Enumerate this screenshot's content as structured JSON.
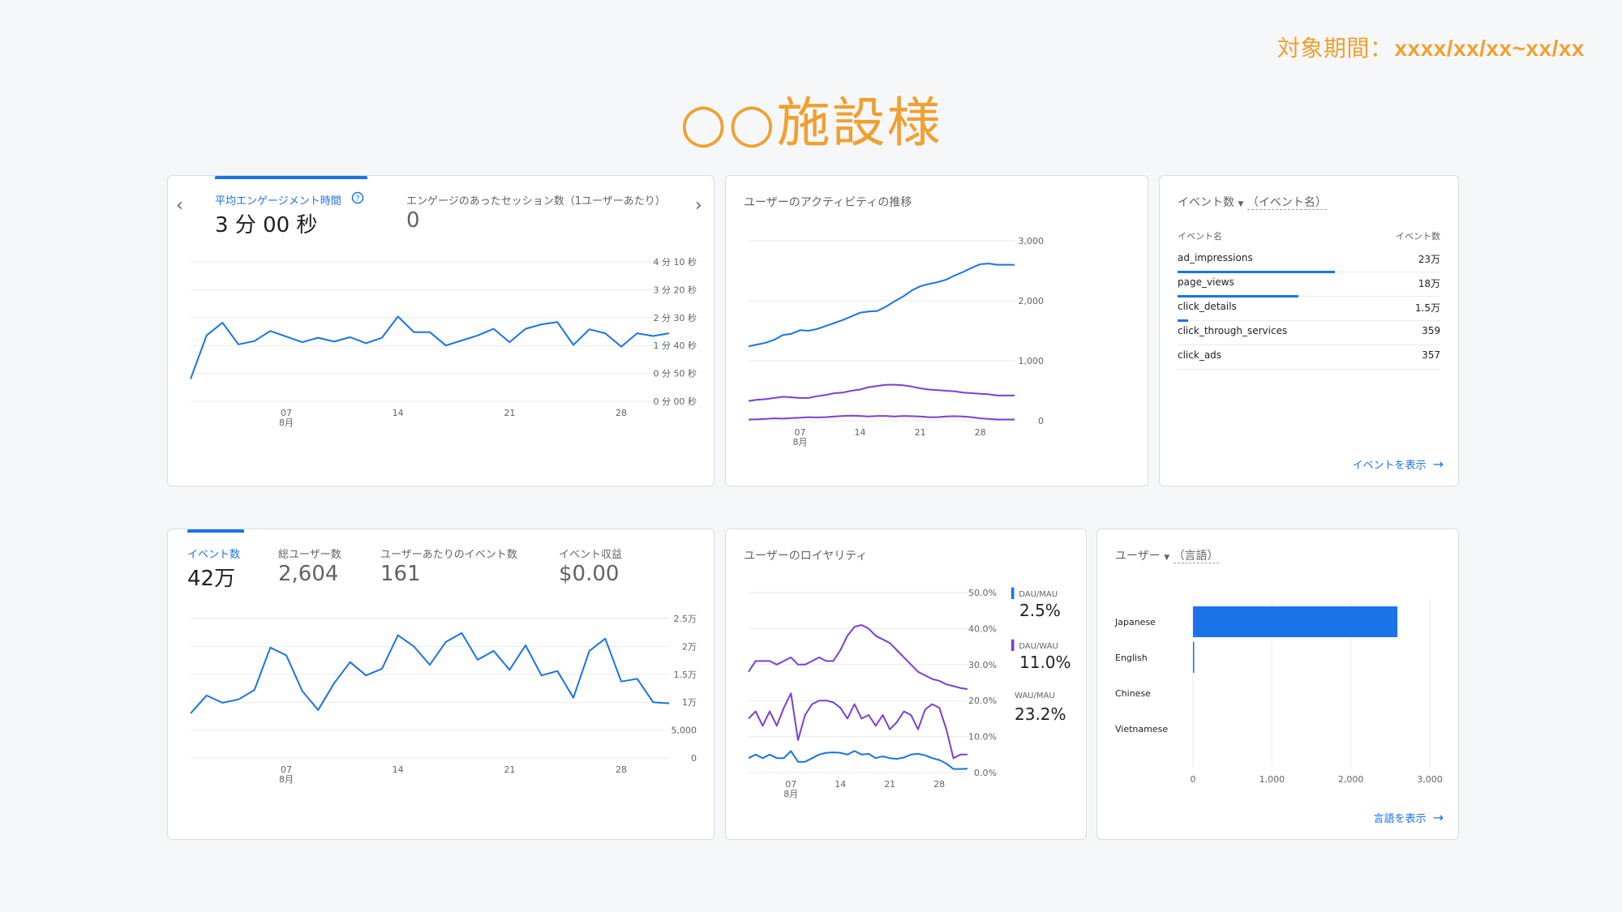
{
  "header": {
    "period_label": "対象期間：",
    "period_value": "xxxx/xx/xx~xx/xx",
    "title": "○○施設様"
  },
  "colors": {
    "accent": "#1a73e8",
    "purple": "#7b3fd6",
    "orange": "#f0a030"
  },
  "engagement_card": {
    "tabs": [
      {
        "label": "平均エンゲージメント時間",
        "value": "3 分 00 秒",
        "selected": true
      },
      {
        "label": "エンゲージのあったセッション数（1ユーザーあたり）",
        "value": "0",
        "selected": false
      }
    ],
    "prev_icon": "chevron-left-icon",
    "next_icon": "chevron-right-icon",
    "help_icon": "help-circle-icon",
    "yticks": [
      "4 分 10 秒",
      "3 分 20 秒",
      "2 分 30 秒",
      "1 分 40 秒",
      "0 分 50 秒",
      "0 分 00 秒"
    ],
    "xticks": [
      "07",
      "14",
      "21",
      "28"
    ],
    "xmonth": "8月"
  },
  "activity_card": {
    "title": "ユーザーのアクティビティの推移",
    "yticks": [
      "3,000",
      "2,000",
      "1,000",
      "0"
    ],
    "xticks": [
      "07",
      "14",
      "21",
      "28"
    ],
    "xmonth": "8月"
  },
  "events_card": {
    "dropdown_label": "イベント数",
    "dimension_label": "（イベント名）",
    "col_name": "イベント名",
    "col_value": "イベント数",
    "rows": [
      {
        "name": "ad_impressions",
        "value": "23万",
        "share": 0.6
      },
      {
        "name": "page_views",
        "value": "18万",
        "share": 0.46
      },
      {
        "name": "click_details",
        "value": "1.5万",
        "share": 0.04
      },
      {
        "name": "click_through_services",
        "value": "359",
        "share": 0
      },
      {
        "name": "click_ads",
        "value": "357",
        "share": 0
      }
    ],
    "link_label": "イベントを表示"
  },
  "events_summary_card": {
    "tabs": [
      {
        "label": "イベント数",
        "value": "42万",
        "selected": true
      },
      {
        "label": "総ユーザー数",
        "value": "2,604",
        "selected": false
      },
      {
        "label": "ユーザーあたりのイベント数",
        "value": "161",
        "selected": false
      },
      {
        "label": "イベント収益",
        "value": "$0.00",
        "selected": false
      }
    ],
    "yticks": [
      "2.5万",
      "2万",
      "1.5万",
      "1万",
      "5,000",
      "0"
    ],
    "xticks": [
      "07",
      "14",
      "21",
      "28"
    ],
    "xmonth": "8月"
  },
  "loyalty_card": {
    "title": "ユーザーのロイヤリティ",
    "yticks": [
      "50.0%",
      "40.0%",
      "30.0%",
      "20.0%",
      "10.0%",
      "0.0%"
    ],
    "xticks": [
      "07",
      "14",
      "21",
      "28"
    ],
    "xmonth": "8月",
    "metrics": [
      {
        "label": "DAU/MAU",
        "value": "2.5%"
      },
      {
        "label": "DAU/WAU",
        "value": "11.0%"
      },
      {
        "label": "WAU/MAU",
        "value": "23.2%"
      }
    ]
  },
  "language_card": {
    "dropdown_label": "ユーザー",
    "dimension_label": "（言語）",
    "xticks": [
      "0",
      "1,000",
      "2,000",
      "3,000"
    ],
    "link_label": "言語を表示"
  },
  "chart_data": [
    {
      "type": "line",
      "title": "平均エンゲージメント時間",
      "x": [
        1,
        2,
        3,
        4,
        5,
        6,
        7,
        8,
        9,
        10,
        11,
        12,
        13,
        14,
        15,
        16,
        17,
        18,
        19,
        20,
        21,
        22,
        23,
        24,
        25,
        26,
        27,
        28,
        29,
        30,
        31
      ],
      "ylim": [
        0,
        250
      ],
      "series": [
        {
          "values": [
            40,
            118,
            141,
            102,
            108,
            126,
            116,
            106,
            114,
            107,
            115,
            104,
            114,
            152,
            124,
            124,
            100,
            109,
            118,
            130,
            106,
            130,
            138,
            142,
            101,
            129,
            122,
            98,
            122,
            117,
            122
          ]
        }
      ]
    },
    {
      "type": "line",
      "title": "ユーザーのアクティビティの推移",
      "x": [
        1,
        2,
        3,
        4,
        5,
        6,
        7,
        8,
        9,
        10,
        11,
        12,
        13,
        14,
        15,
        16,
        17,
        18,
        19,
        20,
        21,
        22,
        23,
        24,
        25,
        26,
        27,
        28,
        29,
        30,
        31,
        32
      ],
      "ylim": [
        0,
        3000
      ],
      "series": [
        {
          "values": [
            1240,
            1270,
            1300,
            1350,
            1430,
            1450,
            1510,
            1500,
            1530,
            1580,
            1630,
            1680,
            1740,
            1800,
            1820,
            1830,
            1900,
            1990,
            2070,
            2170,
            2240,
            2280,
            2310,
            2350,
            2420,
            2480,
            2550,
            2610,
            2620,
            2600,
            2600,
            2600
          ]
        },
        {
          "values": [
            330,
            350,
            360,
            380,
            400,
            390,
            380,
            380,
            410,
            430,
            460,
            470,
            500,
            520,
            560,
            580,
            600,
            600,
            590,
            570,
            540,
            520,
            510,
            500,
            490,
            470,
            460,
            450,
            440,
            420,
            420,
            420
          ]
        },
        {
          "values": [
            20,
            25,
            30,
            40,
            35,
            45,
            50,
            60,
            55,
            60,
            70,
            80,
            85,
            80,
            70,
            80,
            80,
            70,
            80,
            75,
            70,
            60,
            60,
            70,
            75,
            70,
            60,
            40,
            30,
            20,
            20,
            20
          ]
        }
      ]
    },
    {
      "type": "line",
      "title": "イベント数",
      "x": [
        1,
        2,
        3,
        4,
        5,
        6,
        7,
        8,
        9,
        10,
        11,
        12,
        13,
        14,
        15,
        16,
        17,
        18,
        19,
        20,
        21,
        22,
        23,
        24,
        25,
        26,
        27,
        28,
        29,
        30,
        31
      ],
      "ylim": [
        0,
        25000
      ],
      "series": [
        {
          "values": [
            8000,
            11200,
            9900,
            10500,
            12200,
            19800,
            18400,
            12000,
            8600,
            13400,
            17200,
            14800,
            16000,
            22000,
            20000,
            16700,
            20800,
            22400,
            17600,
            19200,
            15800,
            20200,
            14800,
            15600,
            10800,
            19200,
            21400,
            13700,
            14200,
            10000,
            9800
          ]
        }
      ]
    },
    {
      "type": "line",
      "title": "ユーザーのロイヤリティ",
      "x": [
        1,
        2,
        3,
        4,
        5,
        6,
        7,
        8,
        9,
        10,
        11,
        12,
        13,
        14,
        15,
        16,
        17,
        18,
        19,
        20,
        21,
        22,
        23,
        24,
        25,
        26,
        27,
        28,
        29,
        30,
        31,
        32
      ],
      "ylim": [
        0,
        50
      ],
      "series": [
        {
          "name": "DAU/MAU",
          "values": [
            4,
            5,
            4,
            5,
            4,
            4,
            6,
            3,
            3,
            4,
            5,
            5.5,
            5.6,
            5.5,
            5,
            6,
            5,
            5.2,
            4,
            4.5,
            4,
            3.8,
            4.2,
            5,
            5.2,
            4.8,
            4,
            3.5,
            2.5,
            1,
            1,
            1.1
          ]
        },
        {
          "name": "DAU/WAU",
          "values": [
            15,
            17,
            13,
            17,
            13,
            18,
            22,
            9,
            16,
            19,
            20,
            20,
            19.5,
            18,
            15,
            19,
            15,
            16,
            13,
            16,
            12,
            14,
            17,
            16,
            12,
            17.5,
            19,
            18,
            12,
            4,
            5,
            5
          ]
        },
        {
          "name": "WAU/MAU",
          "values": [
            28,
            31,
            31,
            31,
            30,
            31,
            32,
            30,
            30,
            31,
            32,
            31,
            31,
            34,
            38,
            40.5,
            41,
            40,
            38,
            37,
            36,
            34,
            32,
            30,
            28,
            27,
            26,
            25.5,
            24.5,
            24,
            23.5,
            23.2
          ]
        }
      ]
    },
    {
      "type": "bar",
      "title": "ユーザー（言語）",
      "categories": [
        "Japanese",
        "English",
        "Chinese",
        "Vietnamese"
      ],
      "values": [
        2590,
        10,
        0,
        0
      ],
      "xlim": [
        0,
        3000
      ]
    }
  ]
}
